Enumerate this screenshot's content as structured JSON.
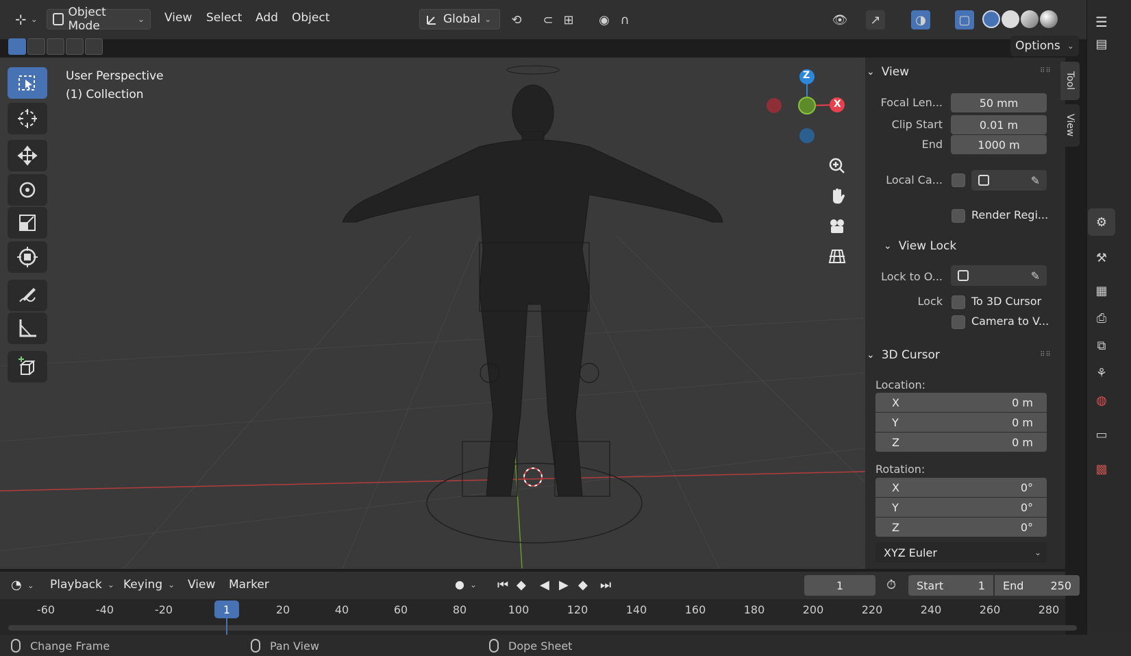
{
  "header": {
    "mode": "Object Mode",
    "menus": [
      "View",
      "Select",
      "Add",
      "Object"
    ],
    "orientation": "Global",
    "options_label": "Options"
  },
  "viewport": {
    "perspective": "User Perspective",
    "collection": "(1) Collection",
    "gizmo": {
      "z": "Z",
      "x": "X"
    }
  },
  "sidebar": {
    "tabs": [
      "Tool",
      "View"
    ],
    "view_section": {
      "title": "View",
      "focal_label": "Focal Len...",
      "focal_value": "50 mm",
      "clip_start_label": "Clip Start",
      "clip_start_value": "0.01 m",
      "clip_end_label": "End",
      "clip_end_value": "1000 m",
      "local_camera_label": "Local Ca...",
      "render_region_label": "Render Regi..."
    },
    "view_lock": {
      "title": "View Lock",
      "lock_object_label": "Lock to O...",
      "lock_label": "Lock",
      "to_cursor_label": "To 3D Cursor",
      "camera_to_view_label": "Camera to V..."
    },
    "cursor": {
      "title": "3D Cursor",
      "location_label": "Location:",
      "location": [
        {
          "axis": "X",
          "value": "0 m"
        },
        {
          "axis": "Y",
          "value": "0 m"
        },
        {
          "axis": "Z",
          "value": "0 m"
        }
      ],
      "rotation_label": "Rotation:",
      "rotation": [
        {
          "axis": "X",
          "value": "0°"
        },
        {
          "axis": "Y",
          "value": "0°"
        },
        {
          "axis": "Z",
          "value": "0°"
        }
      ],
      "rotation_mode": "XYZ Euler"
    }
  },
  "timeline": {
    "menus": [
      "Playback",
      "Keying",
      "View",
      "Marker"
    ],
    "current_frame": "1",
    "start_label": "Start",
    "start_value": "1",
    "end_label": "End",
    "end_value": "250",
    "ticks": [
      "-60",
      "-40",
      "-20",
      "20",
      "40",
      "60",
      "80",
      "100",
      "120",
      "140",
      "160",
      "180",
      "200",
      "220",
      "240",
      "260",
      "280"
    ],
    "marker": "1"
  },
  "status": {
    "items": [
      "Change Frame",
      "Pan View",
      "Dope Sheet"
    ]
  },
  "colors": {
    "accent": "#4772b3",
    "axis_x": "#e8414e",
    "axis_y": "#8ac23b",
    "axis_z": "#2e86d9"
  }
}
